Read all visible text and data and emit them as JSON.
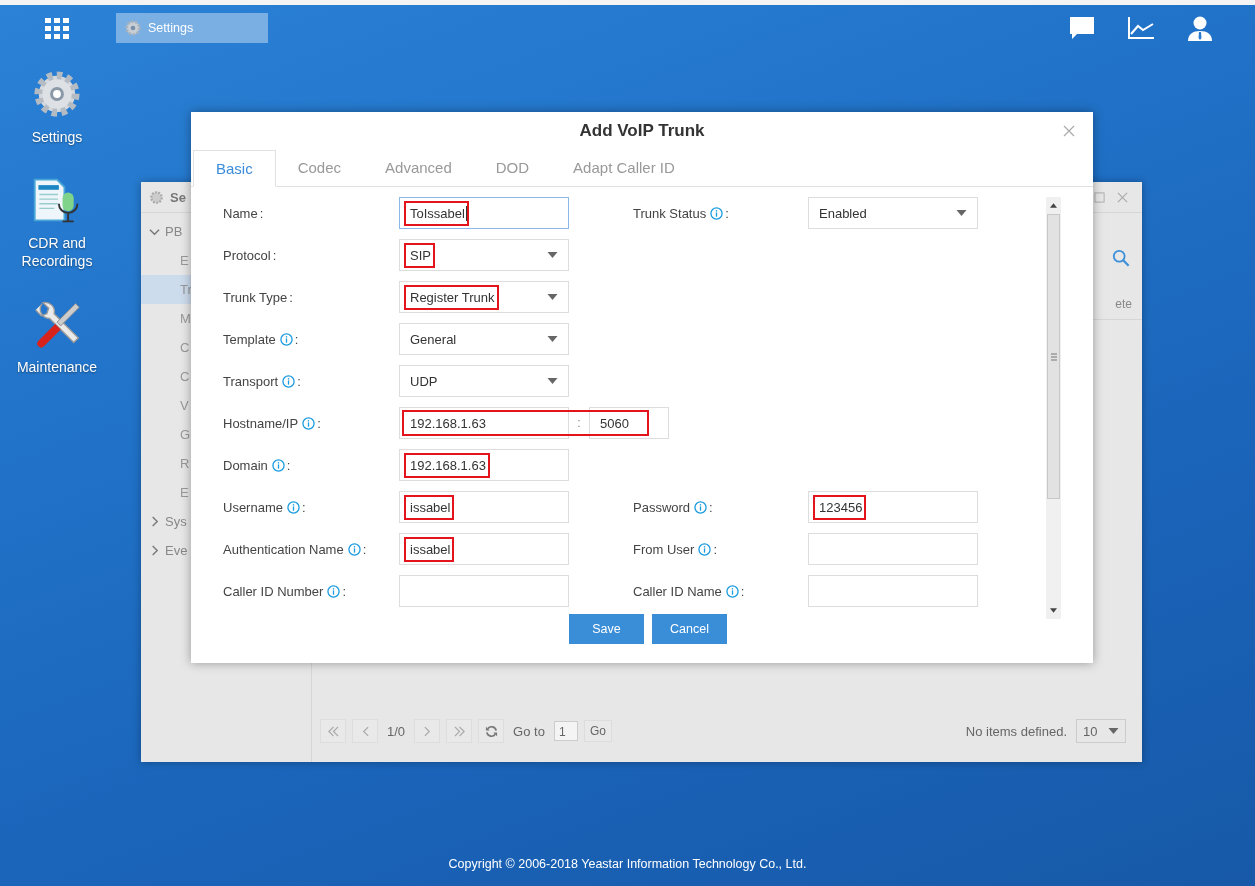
{
  "taskbar": {
    "tasks": [
      {
        "label": "Settings",
        "selected": true
      }
    ]
  },
  "desktop_icons": [
    {
      "kind": "settings",
      "label": "Settings"
    },
    {
      "kind": "cdr",
      "label": "CDR and Recordings"
    },
    {
      "kind": "maintenance",
      "label": "Maintenance"
    }
  ],
  "background_window": {
    "title": "Se",
    "sidebar": [
      {
        "label": "PB",
        "expanded": true,
        "children": [
          {
            "label": "E",
            "selected": false
          },
          {
            "label": "Tr",
            "selected": true
          },
          {
            "label": "M",
            "selected": false
          },
          {
            "label": "C",
            "selected": false
          },
          {
            "label": "C",
            "selected": false
          },
          {
            "label": "V",
            "selected": false
          },
          {
            "label": "G",
            "selected": false
          },
          {
            "label": "R",
            "selected": false
          },
          {
            "label": "E",
            "selected": false
          }
        ]
      },
      {
        "label": "Sys",
        "expanded": false
      },
      {
        "label": "Eve",
        "expanded": false
      }
    ],
    "column_header": "ete",
    "pagination": {
      "page": "1/0",
      "goto_label": "Go to",
      "goto_value": "1",
      "go_button": "Go",
      "status": "No items defined.",
      "page_size": "10"
    }
  },
  "dialog": {
    "title": "Add VoIP Trunk",
    "tabs": [
      {
        "label": "Basic",
        "selected": true
      },
      {
        "label": "Codec",
        "selected": false
      },
      {
        "label": "Advanced",
        "selected": false
      },
      {
        "label": "DOD",
        "selected": false
      },
      {
        "label": "Adapt Caller ID",
        "selected": false
      }
    ],
    "rows": [
      {
        "left": {
          "label": "Name",
          "info": false,
          "colon": ":",
          "kind": "input",
          "value": "ToIssabel",
          "focused": true,
          "highlighted": true
        },
        "right": {
          "label": "Trunk Status",
          "info": true,
          "colon": ":",
          "kind": "select",
          "value": "Enabled",
          "highlighted": false
        }
      },
      {
        "left": {
          "label": "Protocol",
          "info": false,
          "colon": ":",
          "kind": "select",
          "value": "SIP",
          "highlighted": true
        }
      },
      {
        "left": {
          "label": "Trunk Type",
          "info": false,
          "colon": ":",
          "kind": "select",
          "value": "Register Trunk",
          "highlighted": true
        }
      },
      {
        "left": {
          "label": "Template",
          "info": true,
          "colon": ":",
          "kind": "select",
          "value": "General",
          "highlighted": false
        }
      },
      {
        "left": {
          "label": "Transport",
          "info": true,
          "colon": ":",
          "kind": "select",
          "value": "UDP",
          "highlighted": false
        }
      },
      {
        "left": {
          "label": "Hostname/IP",
          "info": true,
          "colon": ":",
          "kind": "hostport",
          "value": "192.168.1.63",
          "separator": ":",
          "port": "5060",
          "highlighted": true
        }
      },
      {
        "left": {
          "label": "Domain",
          "info": true,
          "colon": ":",
          "kind": "input",
          "value": "192.168.1.63",
          "highlighted": true
        }
      },
      {
        "left": {
          "label": "Username",
          "info": true,
          "colon": ":",
          "kind": "input",
          "value": "issabel",
          "highlighted": true
        },
        "right": {
          "label": "Password",
          "info": true,
          "colon": ":",
          "kind": "input",
          "value": "123456",
          "highlighted": true
        }
      },
      {
        "left": {
          "label": "Authentication Name",
          "info": true,
          "colon": ":",
          "kind": "input",
          "value": "issabel",
          "highlighted": true
        },
        "right": {
          "label": "From User",
          "info": true,
          "colon": ":",
          "kind": "input",
          "highlighted": false
        }
      },
      {
        "left": {
          "label": "Caller ID Number",
          "info": true,
          "colon": ":",
          "kind": "input",
          "highlighted": false
        },
        "right": {
          "label": "Caller ID Name",
          "info": true,
          "colon": ":",
          "kind": "input",
          "highlighted": false
        }
      }
    ],
    "buttons": [
      {
        "label": "Save",
        "kind": "primary"
      },
      {
        "label": "Cancel",
        "kind": "primary"
      }
    ]
  },
  "footer": "Copyright © 2006-2018 Yeastar Information Technology Co., Ltd."
}
